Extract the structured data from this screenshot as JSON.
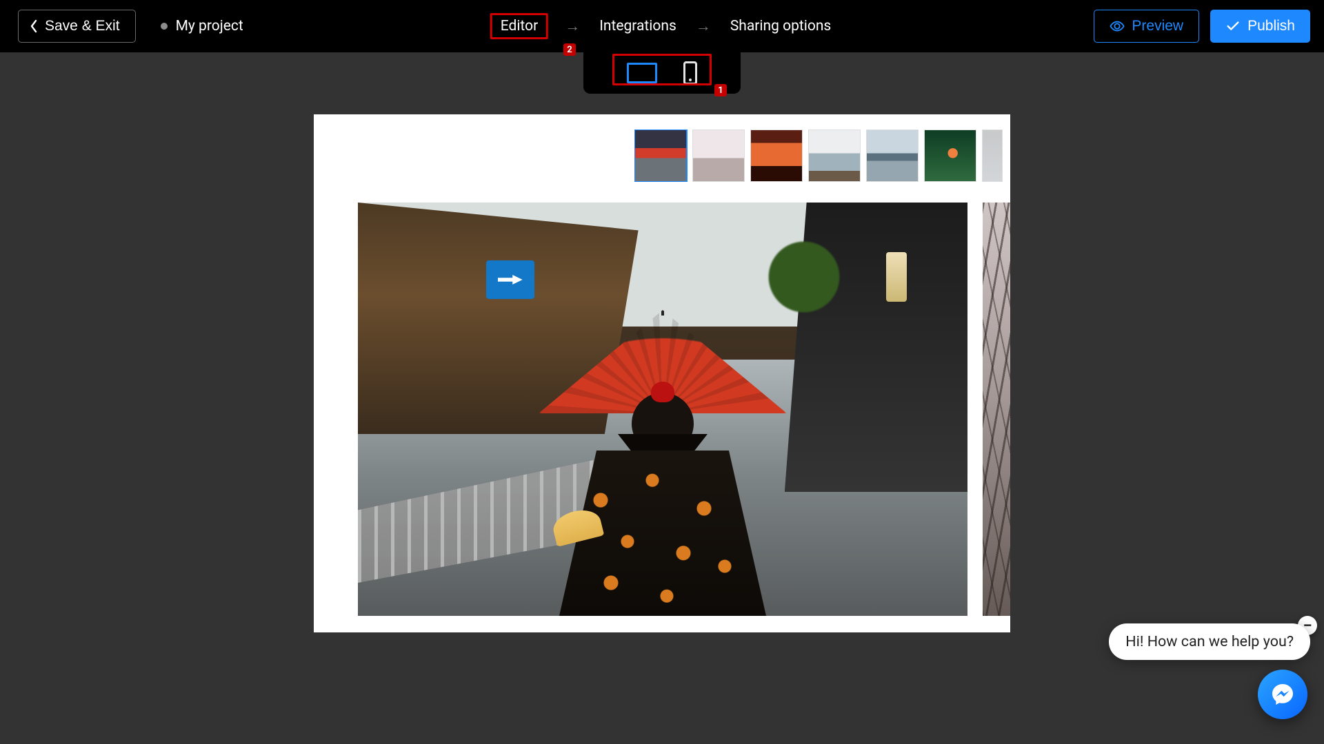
{
  "header": {
    "save_exit": "Save & Exit",
    "project_name": "My project",
    "breadcrumb": {
      "editor": "Editor",
      "integrations": "Integrations",
      "sharing": "Sharing options"
    },
    "preview": "Preview",
    "publish": "Publish"
  },
  "annotations": {
    "editor_badge": "2",
    "device_badge": "1"
  },
  "device_toggle": {
    "desktop_selected": true
  },
  "gallery": {
    "selected_index": 0,
    "thumbnails": [
      "japan-street-umbrella",
      "cherry-blossom",
      "orange-sunset-gate",
      "castle-blossom",
      "pagoda-skyline",
      "koi-green",
      "grey-partial"
    ]
  },
  "chat": {
    "greeting": "Hi! How can we help you?",
    "close_symbol": "−"
  }
}
